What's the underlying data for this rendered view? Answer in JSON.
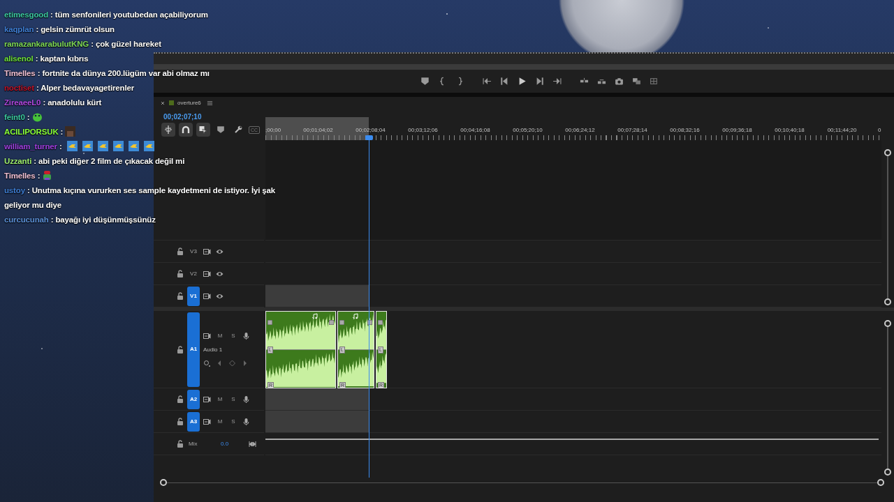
{
  "chat": [
    {
      "user": "etimesgood",
      "color": "#3cc9a0",
      "message": ": tüm senfonileri youtubedan açabiliyorum"
    },
    {
      "user": "kaqplan",
      "color": "#3f7fd6",
      "message": ": gelsin zümrüt olsun"
    },
    {
      "user": "ramazankarabulutKNG",
      "color": "#7ed957",
      "message": ": çok güzel hareket"
    },
    {
      "user": "alisenol",
      "color": "#6ee03c",
      "message": ": kaptan kıbrıs"
    },
    {
      "user": "Timelles",
      "color": "#f0c0d4",
      "message": ": fortnite da dünya 200.lügüm var abi olmaz mı"
    },
    {
      "user": "noctiset",
      "color": "#c0142a",
      "message": ": Alper bedavayagetirenler"
    },
    {
      "user": "ZireaeeL0",
      "color": "#b048e0",
      "message": ": anadolulu kürt"
    },
    {
      "user": "feint0",
      "color": "#3cc9a0",
      "message": ":",
      "emotes": [
        {
          "kind": "blob"
        }
      ]
    },
    {
      "user": "ACILIPORSUK",
      "color": "#8aff3a",
      "message": ":",
      "emotes": [
        {
          "kind": "photo"
        }
      ]
    },
    {
      "user": "william_turner",
      "color": "#a040e0",
      "message": ":",
      "emotes": [
        {
          "kind": "fish"
        },
        {
          "kind": "fish"
        },
        {
          "kind": "fish"
        },
        {
          "kind": "fish"
        },
        {
          "kind": "fish"
        },
        {
          "kind": "fish"
        }
      ]
    },
    {
      "user": "Uzzanti",
      "color": "#9fef6f",
      "message": ": abi peki diğer 2 film de çıkacak değil mi"
    },
    {
      "user": "Timelles",
      "color": "#f0c0d4",
      "message": ":",
      "emotes": [
        {
          "kind": "mascot"
        }
      ]
    },
    {
      "user": "ustoy",
      "color": "#3f7fd6",
      "message": ": Unutma kıçına vururken ses sample kaydetmeni de istiyor. İyi şak geliyor mu diye"
    },
    {
      "user": "curcucunah",
      "color": "#5a8fd6",
      "message": ": bayağı iyi düşünmüşsünüz"
    }
  ],
  "sequence": {
    "name": "overture6",
    "timecode": "00;02;07;10",
    "captions_label": "CC",
    "ruler_labels": [
      ";00;00",
      "00;01;04;02",
      "00;02;08;04",
      "00;03;12;06",
      "00;04;16;08",
      "00;05;20;10",
      "00;06;24;12",
      "00;07;28;14",
      "00;08;32;16",
      "00;09;36;18",
      "00;10;40;18",
      "00;11;44;20",
      "0"
    ]
  },
  "video_tracks": [
    {
      "label": "V3",
      "targeted": false
    },
    {
      "label": "V2",
      "targeted": false
    },
    {
      "label": "V1",
      "targeted": true
    }
  ],
  "audio_tracks": [
    {
      "label": "A1",
      "targeted": true,
      "expanded": true,
      "name": "Audio 1",
      "mute_label": "M",
      "solo_label": "S",
      "clips": [
        {
          "channels": [
            "L",
            "R"
          ]
        },
        {
          "channels": [
            "L",
            "R"
          ]
        },
        {
          "channels": [
            "L",
            "R"
          ]
        }
      ]
    },
    {
      "label": "A2",
      "targeted": true,
      "expanded": false,
      "mute_label": "M",
      "solo_label": "S"
    },
    {
      "label": "A3",
      "targeted": true,
      "expanded": false,
      "mute_label": "M",
      "solo_label": "S"
    }
  ],
  "mix": {
    "label": "Mix",
    "value": "0.0"
  }
}
